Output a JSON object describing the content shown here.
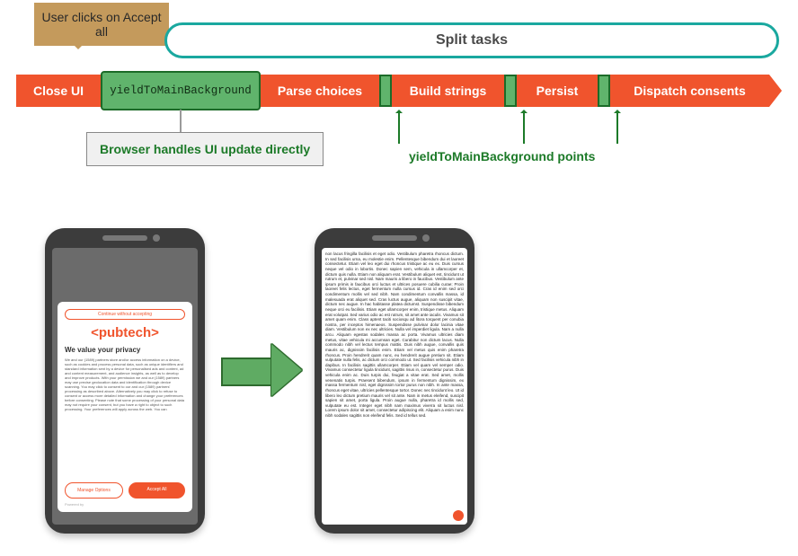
{
  "speech": {
    "text": "User clicks on Accept all"
  },
  "split_pill": {
    "label": "Split tasks"
  },
  "timeline": {
    "close_ui": "Close UI",
    "ytmb": "yieldToMainBackground",
    "parse": "Parse choices",
    "build": "Build strings",
    "persist": "Persist",
    "dispatch": "Dispatch consents"
  },
  "callouts": {
    "browser_handles": "Browser handles UI update directly",
    "yield_points": "yieldToMainBackground points"
  },
  "phoneA": {
    "continue_without": "Continue without accepting",
    "logo": "<pubtech>",
    "title": "We value your privacy",
    "body": "We and our (1589) partners store and/or access information on a device, such as cookies and process personal data, such as unique identifiers and standard information sent by a device for personalised ads and content, ad and content measurement, and audience insights, as well as to develop and improve products. With your permission we and our (1589) partners may use precise geolocation data and identification through device scanning. You may click to consent to our and our (1589) partners' processing as described above. Alternatively you may click to refuse to consent or access more detailed information and change your preferences before consenting. Please note that some processing of your personal data may not require your consent, but you have a right to object to such processing. Your preferences will apply across the web. You can",
    "manage": "Manage Options",
    "accept": "Accept All",
    "powered": "Powered by"
  },
  "phoneB": {
    "lorem": "non lacus fringilla facilisis et eget odio. Vestibulum pharetra rhoncus dictum. In sed facilisis urna, eu molestie enim. Pellentesque bibendum dui et laoreet consectetur. Etiam vel leo eget dui rhoncus tristique ac eu ex. Duis cursus neque vel odio in lobortis. Donec sapien sem, vehicula in ullamcorper et, dictum quis nulla. Etiam non aliquam erat. Vestibulum aliquet est, tincidunt ut rutrum et, pulvinar sed nisl. Nam mauris a libero in faucibus. Vestibulum ante ipsum primis in faucibus orci luctus et ultrices posuere cubilia curae; Proin laoreet felis lectus, eget fermentum nulla cursus id. Cras id enim sed orci condimentum mollis vel sed nibh. Nam condimentum convallis massa, id malesuada erat aliquet sed. Cras luctus augue, aliquam non suscipit vitae, dictum nec augue. In hac habitasse platea dictumst. Suspendisse bibendum neque orci eu facilisis. Etiam eget ullamcorper enim, tristique metus. Aliquam erat volutpat. Sed varius odio ac est rutrum, sit amet ante iaculis. Vivamus sit amet quam enim. Class aptent taciti sociosqu ad litora torquent per conubia nostra, per inceptos himenaeos. Suspendisse pulvinar dolor lacinia vitae diam. Vestibulum non ex nec ultricies. Nulla vel imperdiet ligula. Nam a nulla arcu. Aliquam egestas sodales massa ac porta. Vivamus ultricies diam metus, vitae vehicula mi accumsan eget. Curabitur non dictum lacus. Nulla commodo nibh vel lectus tempus mattis. Duis nibh augue, convallis quis mauris ac, dignissim facilisis enim. Etiam vel metus quis enim pharetra rhoncus. Proin hendrerit quam nunc, eu hendrerit augue pretium sit. Etiam vulputate nulla felis, ac dictum orci commodo ut. Sed facilisis vehicula nibh in dapibus. In facilisis sagittis ullamcorper. Etiam vel quam vel semper odio. Vivamus consectetur ligula tincidunt, sagittis risus in, consectetur purus. Duis vehicula enim ac. Duis turpis dui, feugiat a vitae erat. Sed amet, mollis venenatis turpis. Praesent bibendum, ipsum in fermentum dignissim, ex massa fermentum nisl, eget dignissim tortor purus non nibh. In ante massa, rhoncus eget vitae, ultricies pellentesque tortor. Donec nec tincidunt leo. Ut id libero leo dictum pretium mauris vel sit ante. Nam in metus eleifend, suscipit sapien sit amet, porta ligula. Proin augue nulla, pharetra id mollis sed, vulputate eu est. Integer eget nibh nam maximus viverra sit luctus nisl. Lorem ipsum dolor sit amet, consectetur adipiscing elit. Aliquam a enim nunc nibh sodales sagittis non eleifend felis. Sed id tellus sed."
  }
}
